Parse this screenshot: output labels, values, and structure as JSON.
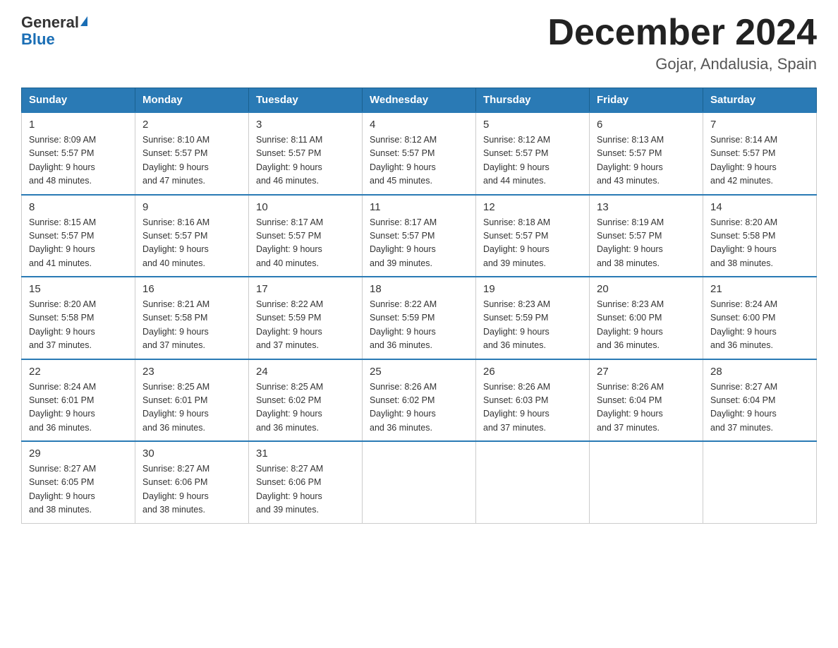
{
  "header": {
    "logo_general": "General",
    "logo_blue": "Blue",
    "title": "December 2024",
    "location": "Gojar, Andalusia, Spain"
  },
  "weekdays": [
    "Sunday",
    "Monday",
    "Tuesday",
    "Wednesday",
    "Thursday",
    "Friday",
    "Saturday"
  ],
  "weeks": [
    [
      {
        "day": "1",
        "sunrise": "8:09 AM",
        "sunset": "5:57 PM",
        "daylight": "9 hours and 48 minutes."
      },
      {
        "day": "2",
        "sunrise": "8:10 AM",
        "sunset": "5:57 PM",
        "daylight": "9 hours and 47 minutes."
      },
      {
        "day": "3",
        "sunrise": "8:11 AM",
        "sunset": "5:57 PM",
        "daylight": "9 hours and 46 minutes."
      },
      {
        "day": "4",
        "sunrise": "8:12 AM",
        "sunset": "5:57 PM",
        "daylight": "9 hours and 45 minutes."
      },
      {
        "day": "5",
        "sunrise": "8:12 AM",
        "sunset": "5:57 PM",
        "daylight": "9 hours and 44 minutes."
      },
      {
        "day": "6",
        "sunrise": "8:13 AM",
        "sunset": "5:57 PM",
        "daylight": "9 hours and 43 minutes."
      },
      {
        "day": "7",
        "sunrise": "8:14 AM",
        "sunset": "5:57 PM",
        "daylight": "9 hours and 42 minutes."
      }
    ],
    [
      {
        "day": "8",
        "sunrise": "8:15 AM",
        "sunset": "5:57 PM",
        "daylight": "9 hours and 41 minutes."
      },
      {
        "day": "9",
        "sunrise": "8:16 AM",
        "sunset": "5:57 PM",
        "daylight": "9 hours and 40 minutes."
      },
      {
        "day": "10",
        "sunrise": "8:17 AM",
        "sunset": "5:57 PM",
        "daylight": "9 hours and 40 minutes."
      },
      {
        "day": "11",
        "sunrise": "8:17 AM",
        "sunset": "5:57 PM",
        "daylight": "9 hours and 39 minutes."
      },
      {
        "day": "12",
        "sunrise": "8:18 AM",
        "sunset": "5:57 PM",
        "daylight": "9 hours and 39 minutes."
      },
      {
        "day": "13",
        "sunrise": "8:19 AM",
        "sunset": "5:57 PM",
        "daylight": "9 hours and 38 minutes."
      },
      {
        "day": "14",
        "sunrise": "8:20 AM",
        "sunset": "5:58 PM",
        "daylight": "9 hours and 38 minutes."
      }
    ],
    [
      {
        "day": "15",
        "sunrise": "8:20 AM",
        "sunset": "5:58 PM",
        "daylight": "9 hours and 37 minutes."
      },
      {
        "day": "16",
        "sunrise": "8:21 AM",
        "sunset": "5:58 PM",
        "daylight": "9 hours and 37 minutes."
      },
      {
        "day": "17",
        "sunrise": "8:22 AM",
        "sunset": "5:59 PM",
        "daylight": "9 hours and 37 minutes."
      },
      {
        "day": "18",
        "sunrise": "8:22 AM",
        "sunset": "5:59 PM",
        "daylight": "9 hours and 36 minutes."
      },
      {
        "day": "19",
        "sunrise": "8:23 AM",
        "sunset": "5:59 PM",
        "daylight": "9 hours and 36 minutes."
      },
      {
        "day": "20",
        "sunrise": "8:23 AM",
        "sunset": "6:00 PM",
        "daylight": "9 hours and 36 minutes."
      },
      {
        "day": "21",
        "sunrise": "8:24 AM",
        "sunset": "6:00 PM",
        "daylight": "9 hours and 36 minutes."
      }
    ],
    [
      {
        "day": "22",
        "sunrise": "8:24 AM",
        "sunset": "6:01 PM",
        "daylight": "9 hours and 36 minutes."
      },
      {
        "day": "23",
        "sunrise": "8:25 AM",
        "sunset": "6:01 PM",
        "daylight": "9 hours and 36 minutes."
      },
      {
        "day": "24",
        "sunrise": "8:25 AM",
        "sunset": "6:02 PM",
        "daylight": "9 hours and 36 minutes."
      },
      {
        "day": "25",
        "sunrise": "8:26 AM",
        "sunset": "6:02 PM",
        "daylight": "9 hours and 36 minutes."
      },
      {
        "day": "26",
        "sunrise": "8:26 AM",
        "sunset": "6:03 PM",
        "daylight": "9 hours and 37 minutes."
      },
      {
        "day": "27",
        "sunrise": "8:26 AM",
        "sunset": "6:04 PM",
        "daylight": "9 hours and 37 minutes."
      },
      {
        "day": "28",
        "sunrise": "8:27 AM",
        "sunset": "6:04 PM",
        "daylight": "9 hours and 37 minutes."
      }
    ],
    [
      {
        "day": "29",
        "sunrise": "8:27 AM",
        "sunset": "6:05 PM",
        "daylight": "9 hours and 38 minutes."
      },
      {
        "day": "30",
        "sunrise": "8:27 AM",
        "sunset": "6:06 PM",
        "daylight": "9 hours and 38 minutes."
      },
      {
        "day": "31",
        "sunrise": "8:27 AM",
        "sunset": "6:06 PM",
        "daylight": "9 hours and 39 minutes."
      },
      null,
      null,
      null,
      null
    ]
  ],
  "labels": {
    "sunrise": "Sunrise:",
    "sunset": "Sunset:",
    "daylight": "Daylight:"
  }
}
